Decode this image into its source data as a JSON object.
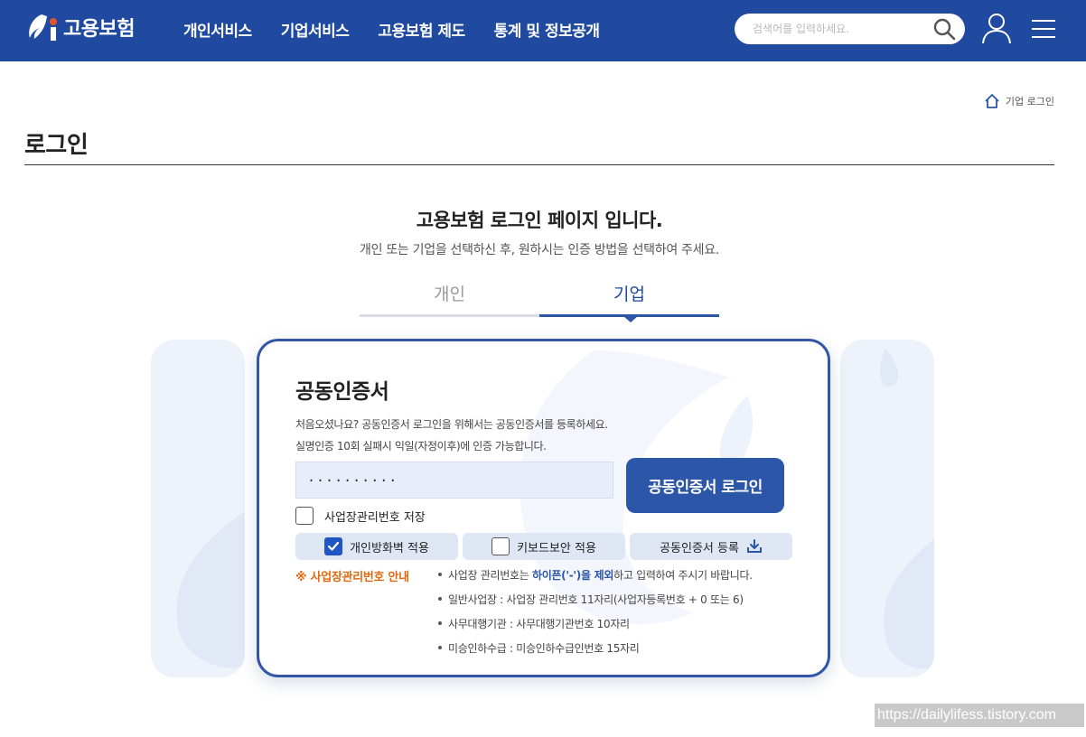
{
  "header": {
    "logo_text": "고용보험",
    "nav": [
      "개인서비스",
      "기업서비스",
      "고용보험 제도",
      "통계 및 정보공개"
    ],
    "search_placeholder": "검색어를 입력하세요."
  },
  "breadcrumb": {
    "text": "기업 로그인"
  },
  "page": {
    "title": "로그인",
    "heading": "고용보험 로그인 페이지 입니다.",
    "subheading": "개인 또는 기업을 선택하신 후, 원하시는 인증 방법을 선택하여 주세요."
  },
  "tabs": {
    "personal": "개인",
    "business": "기업",
    "active": "business"
  },
  "card": {
    "title": "공동인증서",
    "desc1": "처음오셨나요? 공동인증서 로그인을 위해서는 공동인증서를 등록하세요.",
    "desc2": "실명인증 10회 실패시 익일(자정이후)에 인증 가능합니다.",
    "input_value": "··········",
    "login_button": "공동인증서 로그인",
    "save_label": "사업장관리번호 저장",
    "options": {
      "firewall": "개인방화벽 적용",
      "keyboard": "키보드보안 적용",
      "register": "공동인증서 등록"
    },
    "guide_title": "※ 사업장관리번호 안내",
    "guide": {
      "line1_pre": "사업장 관리번호는 ",
      "line1_hl": "하이픈('-')을 제외",
      "line1_post": "하고 입력하여 주시기 바랍니다.",
      "line2": "일반사업장 : 사업장 관리번호 11자리(사업자등록번호 + 0 또는 6)",
      "line3": "사무대행기관 : 사무대행기관번호 10자리",
      "line4": "미승인하수급 : 미승인하수급인번호 15자리"
    }
  },
  "watermark": "https://dailylifess.tistory.com",
  "colors": {
    "header": "#1f4aa0",
    "primary": "#2c56a8",
    "accent": "#e06a12",
    "checkbox": "#1f55c4"
  }
}
